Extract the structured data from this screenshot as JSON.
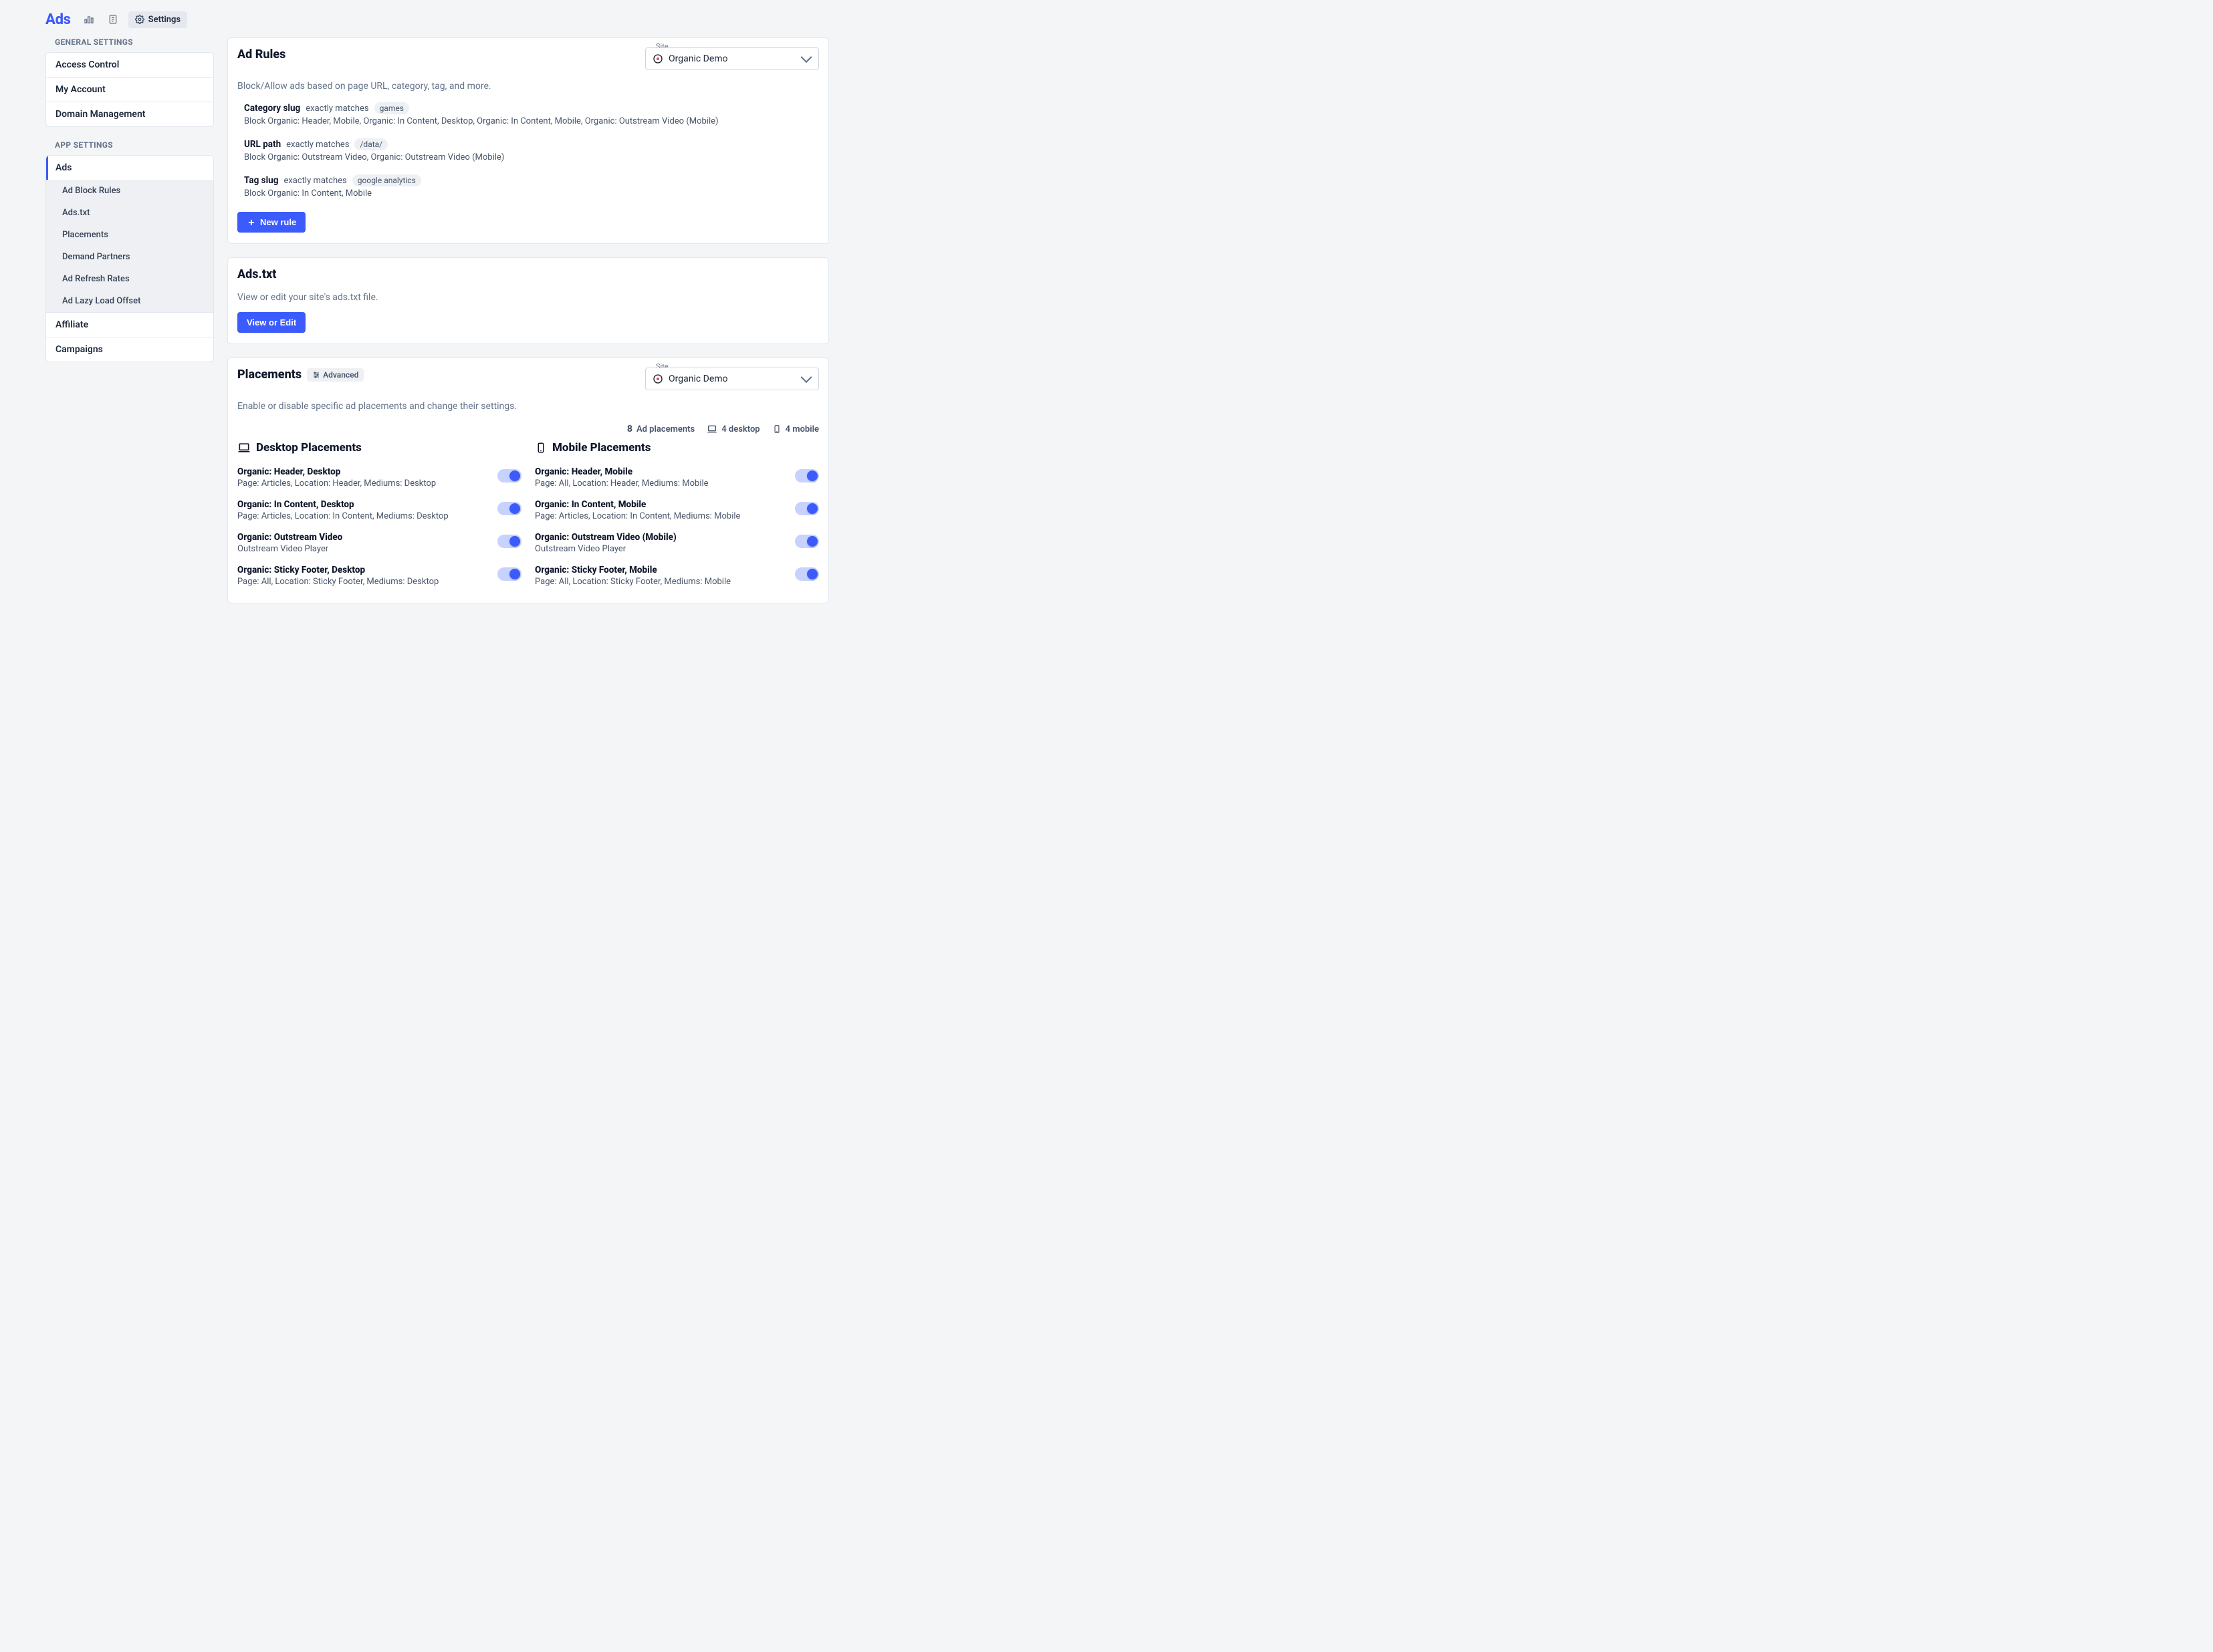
{
  "topbar": {
    "brand": "Ads",
    "settings_label": "Settings"
  },
  "sidebar": {
    "general_header": "GENERAL SETTINGS",
    "general_items": [
      "Access Control",
      "My Account",
      "Domain Management"
    ],
    "app_header": "APP SETTINGS",
    "ads_label": "Ads",
    "ads_sub": [
      "Ad Block Rules",
      "Ads.txt",
      "Placements",
      "Demand Partners",
      "Ad Refresh Rates",
      "Ad Lazy Load Offset"
    ],
    "affiliate_label": "Affiliate",
    "campaigns_label": "Campaigns"
  },
  "site_selector": {
    "legend": "Site",
    "value": "Organic Demo"
  },
  "ad_rules": {
    "title": "Ad Rules",
    "desc": "Block/Allow ads based on page URL, category, tag, and more.",
    "rules": [
      {
        "field": "Category slug",
        "match": "exactly matches",
        "value": "games",
        "effect": "Block Organic: Header, Mobile, Organic: In Content, Desktop, Organic: In Content, Mobile, Organic: Outstream Video (Mobile)"
      },
      {
        "field": "URL path",
        "match": "exactly matches",
        "value": "/data/",
        "effect": "Block Organic: Outstream Video, Organic: Outstream Video (Mobile)"
      },
      {
        "field": "Tag slug",
        "match": "exactly matches",
        "value": "google analytics",
        "effect": "Block Organic: In Content, Mobile"
      }
    ],
    "new_rule_label": "New rule"
  },
  "adstxt": {
    "title": "Ads.txt",
    "desc": "View or edit your site's ads.txt file.",
    "button_label": "View or Edit"
  },
  "placements": {
    "title": "Placements",
    "advanced_label": "Advanced",
    "desc": "Enable or disable specific ad placements and change their settings.",
    "summary": {
      "total": "8",
      "total_label": "Ad placements",
      "desktop": "4 desktop",
      "mobile": "4 mobile"
    },
    "desktop_heading": "Desktop Placements",
    "mobile_heading": "Mobile Placements",
    "desktop": [
      {
        "name": "Organic: Header, Desktop",
        "detail": "Page: Articles, Location: Header, Mediums: Desktop"
      },
      {
        "name": "Organic: In Content, Desktop",
        "detail": "Page: Articles, Location: In Content, Mediums: Desktop"
      },
      {
        "name": "Organic: Outstream Video",
        "detail": "Outstream Video Player"
      },
      {
        "name": "Organic: Sticky Footer, Desktop",
        "detail": "Page: All, Location: Sticky Footer, Mediums: Desktop"
      }
    ],
    "mobile": [
      {
        "name": "Organic: Header, Mobile",
        "detail": "Page: All, Location: Header, Mediums: Mobile"
      },
      {
        "name": "Organic: In Content, Mobile",
        "detail": "Page: Articles, Location: In Content, Mediums: Mobile"
      },
      {
        "name": "Organic: Outstream Video (Mobile)",
        "detail": "Outstream Video Player"
      },
      {
        "name": "Organic: Sticky Footer, Mobile",
        "detail": "Page: All, Location: Sticky Footer, Mediums: Mobile"
      }
    ]
  }
}
